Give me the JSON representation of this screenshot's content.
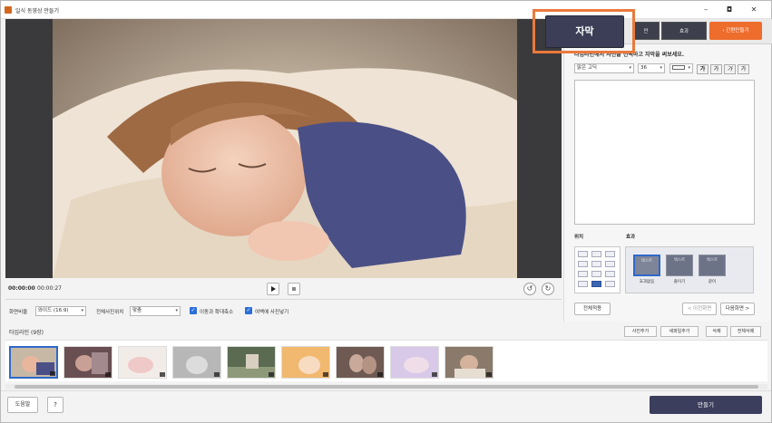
{
  "window": {
    "title": "일식 동영상 만들기",
    "minimize": "–",
    "maximize": "◘",
    "close": "✕"
  },
  "player": {
    "current_time": "00:00:00",
    "total_time": "00:00:27"
  },
  "options": {
    "ratio_label": "화면비율",
    "ratio_value": "와이드 (16:9)",
    "position_label": "전체사진위치",
    "position_value": "맞춤",
    "zoom_label": "이동과 확대축소",
    "margin_label": "여백에 사진넣기"
  },
  "panel": {
    "tab_fx": "효과",
    "tab_small": "만",
    "simple_btn": "간편만들기",
    "instruction": "타임라인에서 사진을 선택하고 자막을 써보세요.",
    "font_value": "맑은 고딕",
    "size_value": "36",
    "b1": "가",
    "b2": "가",
    "b3": "가",
    "b4": "가",
    "position_section": "위치",
    "effect_section": "효과",
    "effects": [
      {
        "thumb": "텍스트",
        "label": "효과없음"
      },
      {
        "thumb": "텍스트",
        "label": "줄이기"
      },
      {
        "thumb": "텍스트",
        "label": "같이"
      }
    ],
    "apply_all": "전체적용",
    "prev_btn": "< 이전화면",
    "next_btn": "다음화면 >"
  },
  "timeline": {
    "title": "타임라인 (9장)",
    "add_photo": "사진추가",
    "new_open": "새파일추가",
    "delete": "삭제",
    "delete_all": "전체삭제"
  },
  "bottom": {
    "help": "도움말",
    "question": "?",
    "make": "만들기"
  },
  "callout": {
    "label": "자막"
  }
}
